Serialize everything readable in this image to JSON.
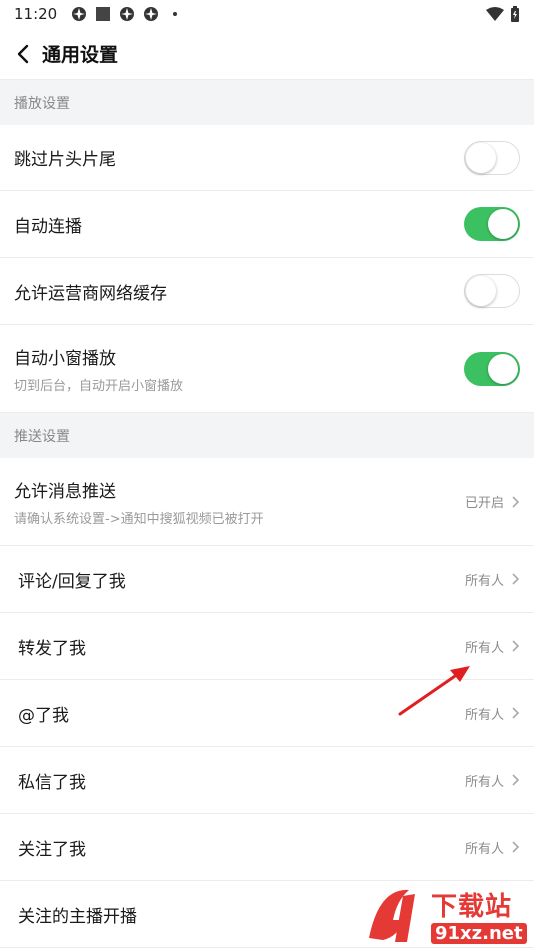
{
  "status_bar": {
    "time": "11:20"
  },
  "header": {
    "title": "通用设置"
  },
  "sections": [
    {
      "title": "播放设置",
      "items": [
        {
          "label": "跳过片头片尾",
          "toggle": "off"
        },
        {
          "label": "自动连播",
          "toggle": "on"
        },
        {
          "label": "允许运营商网络缓存",
          "toggle": "off"
        },
        {
          "label": "自动小窗播放",
          "sub": "切到后台，自动开启小窗播放",
          "toggle": "on"
        }
      ]
    },
    {
      "title": "推送设置",
      "items": [
        {
          "label": "允许消息推送",
          "sub": "请确认系统设置->通知中搜狐视频已被打开",
          "value": "已开启"
        },
        {
          "label": "评论/回复了我",
          "value": "所有人"
        },
        {
          "label": "转发了我",
          "value": "所有人"
        },
        {
          "label": "@了我",
          "value": "所有人"
        },
        {
          "label": "私信了我",
          "value": "所有人"
        },
        {
          "label": "关注了我",
          "value": "所有人"
        },
        {
          "label": "关注的主播开播",
          "value": ""
        }
      ]
    }
  ],
  "watermark": {
    "main": "下载站",
    "sub": "91xz.net"
  },
  "colors": {
    "toggle_on": "#3cc162",
    "section_bg": "#f3f4f6",
    "annotation_arrow": "#e02020"
  }
}
